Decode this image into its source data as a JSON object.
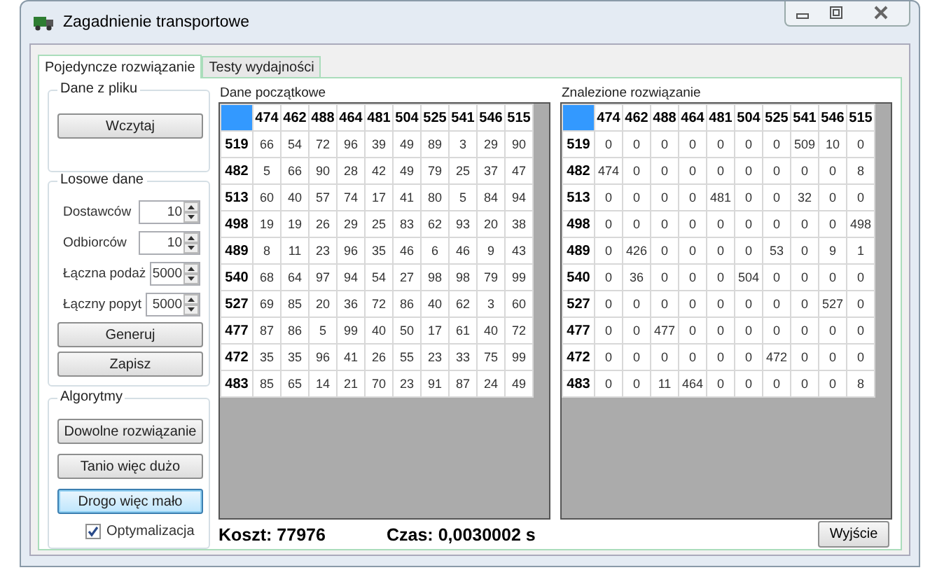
{
  "window": {
    "title": "Zagadnienie transportowe"
  },
  "tabs": [
    {
      "label": "Pojedyncze rozwiązanie",
      "selected": true
    },
    {
      "label": "Testy wydajności",
      "selected": false
    }
  ],
  "dane_z_pliku": {
    "title": "Dane z pliku",
    "buttons": [
      {
        "label": "Wczytaj",
        "focused": false
      }
    ]
  },
  "losowe_dane": {
    "title": "Losowe dane",
    "fields": [
      {
        "label": "Dostawców",
        "value": "10"
      },
      {
        "label": "Odbiorców",
        "value": "10"
      },
      {
        "label": "Łączna podaż",
        "value": "5000"
      },
      {
        "label": "Łączny popyt",
        "value": "5000"
      }
    ],
    "buttons": [
      {
        "label": "Generuj",
        "focused": false
      },
      {
        "label": "Zapisz",
        "focused": false
      }
    ]
  },
  "algorytmy": {
    "title": "Algorytmy",
    "buttons": [
      {
        "label": "Dowolne rozwiązanie",
        "focused": false
      },
      {
        "label": "Tanio więc dużo",
        "focused": false
      },
      {
        "label": "Drogo więc mało",
        "focused": true
      }
    ],
    "checkbox": {
      "label": "Optymalizacja",
      "checked": true
    }
  },
  "tables": [
    {
      "title": "Dane początkowe",
      "columns": [
        "474",
        "462",
        "488",
        "464",
        "481",
        "504",
        "525",
        "541",
        "546",
        "515"
      ],
      "rows": [
        {
          "header": "519",
          "cells": [
            "66",
            "54",
            "72",
            "96",
            "39",
            "49",
            "89",
            "3",
            "29",
            "90"
          ]
        },
        {
          "header": "482",
          "cells": [
            "5",
            "66",
            "90",
            "28",
            "42",
            "49",
            "79",
            "25",
            "37",
            "47"
          ]
        },
        {
          "header": "513",
          "cells": [
            "60",
            "40",
            "57",
            "74",
            "17",
            "41",
            "80",
            "5",
            "84",
            "94"
          ]
        },
        {
          "header": "498",
          "cells": [
            "19",
            "19",
            "26",
            "29",
            "25",
            "83",
            "62",
            "93",
            "20",
            "38"
          ]
        },
        {
          "header": "489",
          "cells": [
            "8",
            "11",
            "23",
            "96",
            "35",
            "46",
            "6",
            "46",
            "9",
            "43"
          ]
        },
        {
          "header": "540",
          "cells": [
            "68",
            "64",
            "97",
            "94",
            "54",
            "27",
            "98",
            "98",
            "79",
            "99"
          ]
        },
        {
          "header": "527",
          "cells": [
            "69",
            "85",
            "20",
            "36",
            "72",
            "86",
            "40",
            "62",
            "3",
            "60"
          ]
        },
        {
          "header": "477",
          "cells": [
            "87",
            "86",
            "5",
            "99",
            "40",
            "50",
            "17",
            "61",
            "40",
            "72"
          ]
        },
        {
          "header": "472",
          "cells": [
            "35",
            "35",
            "96",
            "41",
            "26",
            "55",
            "23",
            "33",
            "75",
            "99"
          ]
        },
        {
          "header": "483",
          "cells": [
            "85",
            "65",
            "14",
            "21",
            "70",
            "23",
            "91",
            "87",
            "24",
            "49"
          ]
        }
      ]
    },
    {
      "title": "Znalezione rozwiązanie",
      "columns": [
        "474",
        "462",
        "488",
        "464",
        "481",
        "504",
        "525",
        "541",
        "546",
        "515"
      ],
      "rows": [
        {
          "header": "519",
          "cells": [
            "0",
            "0",
            "0",
            "0",
            "0",
            "0",
            "0",
            "509",
            "10",
            "0"
          ]
        },
        {
          "header": "482",
          "cells": [
            "474",
            "0",
            "0",
            "0",
            "0",
            "0",
            "0",
            "0",
            "0",
            "8"
          ]
        },
        {
          "header": "513",
          "cells": [
            "0",
            "0",
            "0",
            "0",
            "481",
            "0",
            "0",
            "32",
            "0",
            "0"
          ]
        },
        {
          "header": "498",
          "cells": [
            "0",
            "0",
            "0",
            "0",
            "0",
            "0",
            "0",
            "0",
            "0",
            "498"
          ]
        },
        {
          "header": "489",
          "cells": [
            "0",
            "426",
            "0",
            "0",
            "0",
            "0",
            "53",
            "0",
            "9",
            "1"
          ]
        },
        {
          "header": "540",
          "cells": [
            "0",
            "36",
            "0",
            "0",
            "0",
            "504",
            "0",
            "0",
            "0",
            "0"
          ]
        },
        {
          "header": "527",
          "cells": [
            "0",
            "0",
            "0",
            "0",
            "0",
            "0",
            "0",
            "0",
            "527",
            "0"
          ]
        },
        {
          "header": "477",
          "cells": [
            "0",
            "0",
            "477",
            "0",
            "0",
            "0",
            "0",
            "0",
            "0",
            "0"
          ]
        },
        {
          "header": "472",
          "cells": [
            "0",
            "0",
            "0",
            "0",
            "0",
            "0",
            "472",
            "0",
            "0",
            "0"
          ]
        },
        {
          "header": "483",
          "cells": [
            "0",
            "0",
            "11",
            "464",
            "0",
            "0",
            "0",
            "0",
            "0",
            "8"
          ]
        }
      ]
    }
  ],
  "koszt": "Koszt: 77976",
  "czas": "Czas: 0,0030002 s",
  "exit_button": "Wyjście"
}
